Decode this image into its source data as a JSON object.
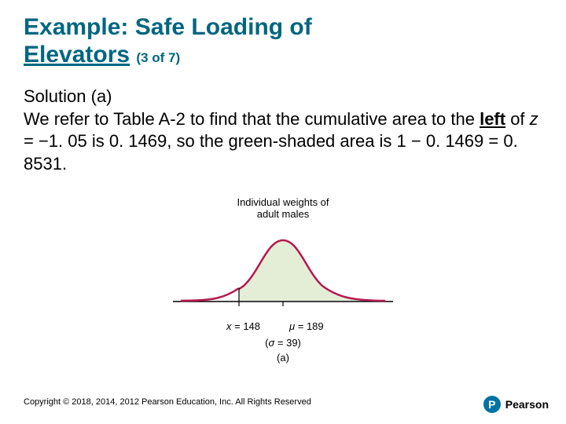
{
  "title": {
    "line1": "Example: Safe Loading of",
    "line2_main": "Elevators",
    "line2_sub": "(3 of 7)"
  },
  "body": {
    "heading": "Solution (a)",
    "t1": "We refer to Table A-2 to find that the cumulative area to the ",
    "t2_bold": "left",
    "t3": " of ",
    "t4_ital": "z",
    "t5": " = −1. 05 is 0. 1469, so the green-shaded area is 1 − 0. 1469 = 0. 8531."
  },
  "figure": {
    "caption_l1": "Individual weights of",
    "caption_l2": "adult males",
    "x_label_prefix": "x",
    "x_label_val": " = 148",
    "mu_label_prefix": "μ",
    "mu_label_val": " = 189",
    "sigma_open": "(",
    "sigma_sym": "σ",
    "sigma_val": " = 39)",
    "part": "(a)"
  },
  "footer": "Copyright © 2018, 2014, 2012 Pearson Education, Inc. All Rights Reserved",
  "brand": {
    "initial": "P",
    "name": "Pearson"
  },
  "chart_data": {
    "type": "area",
    "title": "Individual weights of adult males",
    "distribution": "normal",
    "mu": 189,
    "sigma": 39,
    "marked_x": 148,
    "marked_z": -1.05,
    "left_tail_area": 0.1469,
    "shaded_right_area": 0.8531,
    "xlabel": "weight",
    "ylabel": "",
    "x_ticks": [
      148,
      189
    ],
    "shaded_region": "x >= 148",
    "part_label": "(a)"
  }
}
